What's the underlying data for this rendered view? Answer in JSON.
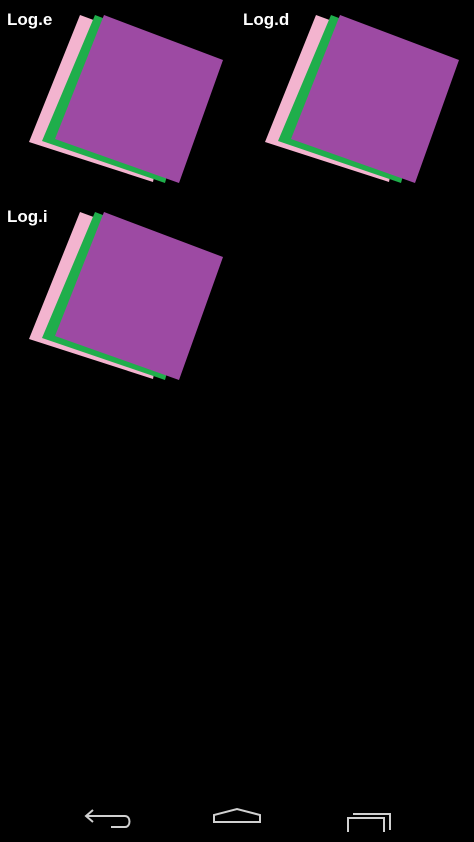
{
  "tiles": [
    {
      "label": "Log.e"
    },
    {
      "label": "Log.d"
    },
    {
      "label": "Log.i"
    }
  ],
  "colors": {
    "background": "#000000",
    "pink": "#f3b4cf",
    "green": "#1fae4b",
    "purple": "#9d4aa3",
    "label": "#ffffff",
    "nav_icon": "#d0d0d0"
  },
  "navbar": {
    "back_icon": "back-icon",
    "home_icon": "home-icon",
    "recents_icon": "recents-icon"
  }
}
